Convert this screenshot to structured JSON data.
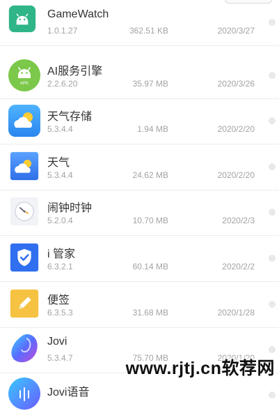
{
  "apps": [
    {
      "name": "GameWatch",
      "version": "1.0.1.27",
      "size": "362.51 KB",
      "date": "2020/3/27",
      "icon": "android-icon"
    },
    {
      "name": "AI服务引擎",
      "version": "2.2.6.20",
      "size": "35.97 MB",
      "date": "2020/3/26",
      "icon": "apk-android-icon",
      "icon_text": "APK"
    },
    {
      "name": "天气存储",
      "version": "5.3.4.4",
      "size": "1.94 MB",
      "date": "2020/2/20",
      "icon": "weather-cloud-icon"
    },
    {
      "name": "天气",
      "version": "5.3.4.4",
      "size": "24.62 MB",
      "date": "2020/2/20",
      "icon": "weather-cloud-icon"
    },
    {
      "name": "闹钟时钟",
      "version": "5.2.0.4",
      "size": "10.70 MB",
      "date": "2020/2/3",
      "icon": "clock-icon"
    },
    {
      "name": "i 管家",
      "version": "6.3.2.1",
      "size": "60.14 MB",
      "date": "2020/2/2",
      "icon": "shield-check-icon"
    },
    {
      "name": "便签",
      "version": "6.3.5.3",
      "size": "31.68 MB",
      "date": "2020/1/28",
      "icon": "pencil-note-icon"
    },
    {
      "name": "Jovi",
      "version": "5.3.4.7",
      "size": "75.70 MB",
      "date": "2020/1/20",
      "icon": "jovi-icon"
    },
    {
      "name": "Jovi语音",
      "version": "",
      "size": "",
      "date": "",
      "icon": "jovi-voice-icon"
    }
  ],
  "watermark": "www.rjtj.cn软荐网",
  "colors": {
    "android_green": "#3ddc84",
    "weather_blue": "#3b8cf2",
    "shield_blue": "#2f6ff0",
    "note_yellow": "#f5c242"
  }
}
